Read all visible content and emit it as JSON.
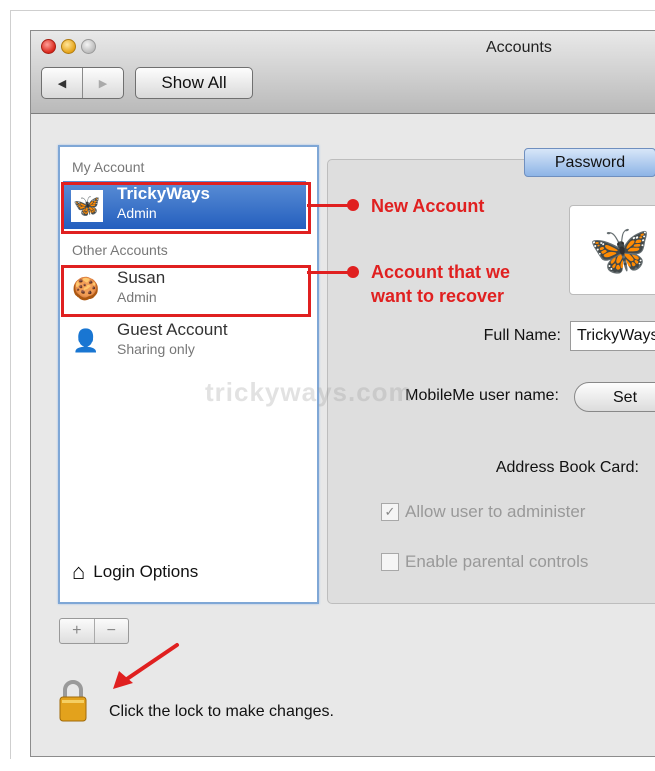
{
  "window": {
    "title": "Accounts",
    "nav_back": "◀",
    "nav_forward": "▶",
    "show_all": "Show All"
  },
  "sidebar": {
    "my_account_header": "My Account",
    "other_accounts_header": "Other Accounts",
    "accounts": [
      {
        "name": "TrickyWays",
        "role": "Admin",
        "icon": "butterfly-icon",
        "glyph": "🦋"
      },
      {
        "name": "Susan",
        "role": "Admin",
        "icon": "gingerbread-icon",
        "glyph": "🍪"
      },
      {
        "name": "Guest Account",
        "role": "Sharing only",
        "icon": "person-silhouette-icon",
        "glyph": "👤"
      }
    ],
    "login_options": "Login Options"
  },
  "controls": {
    "add": "+",
    "remove": "−"
  },
  "lock_text": "Click the lock to make changes.",
  "detail": {
    "tab_password": "Password",
    "picture_glyph": "🦋",
    "full_name_label": "Full Name:",
    "full_name_value": "TrickyWays",
    "mobileme_label": "MobileMe user name:",
    "set_button": "Set",
    "address_book_label": "Address Book Card:",
    "allow_admin_label": "Allow user to administer",
    "allow_admin_checked": true,
    "parental_label": "Enable parental controls",
    "parental_checked": false
  },
  "watermark": "trickyways.com",
  "annotations": {
    "new_account": "New Account",
    "recover_line1": "Account that we",
    "recover_line2": "want to recover"
  },
  "colors": {
    "selection": "#245fbe",
    "annotation_red": "#e02020",
    "sidebar_border": "#7fa7d6"
  }
}
